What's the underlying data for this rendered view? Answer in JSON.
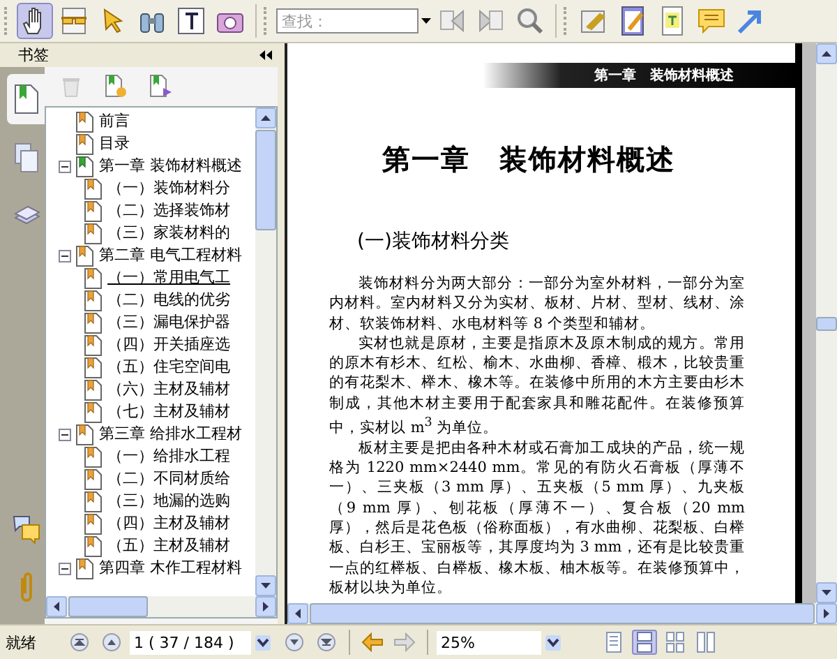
{
  "toolbar": {
    "tools": [
      {
        "kind": "hand",
        "selected": true
      },
      {
        "kind": "glasses",
        "selected": false
      },
      {
        "kind": "arrow",
        "selected": false
      },
      {
        "kind": "binoculars",
        "selected": false
      },
      {
        "kind": "text",
        "selected": false
      },
      {
        "kind": "camera",
        "selected": false
      }
    ],
    "search": {
      "placeholder": "查找："
    },
    "annotation_tools": [
      {
        "kind": "link"
      },
      {
        "kind": "note"
      },
      {
        "kind": "textbox"
      },
      {
        "kind": "comment"
      },
      {
        "kind": "arrow"
      }
    ]
  },
  "sidebar": {
    "title": "书签",
    "tabs": [
      {
        "kind": "bookmarks",
        "selected": true
      },
      {
        "kind": "pages",
        "selected": false
      },
      {
        "kind": "layers",
        "selected": false
      },
      {
        "kind": "comments",
        "selected": false
      },
      {
        "kind": "attachments",
        "selected": false
      }
    ],
    "bookmarks": [
      {
        "label": "前言",
        "current": false,
        "selected": false
      },
      {
        "label": "目录",
        "current": false,
        "selected": false
      },
      {
        "label": "第一章  装饰材料概述",
        "current": true,
        "selected": false,
        "expanded": true,
        "children": [
          {
            "label": "（一）装饰材料分",
            "current": false,
            "selected": false
          },
          {
            "label": "（二）选择装饰材",
            "current": false,
            "selected": false
          },
          {
            "label": "（三）家装材料的",
            "current": false,
            "selected": false
          }
        ]
      },
      {
        "label": "第二章  电气工程材料",
        "current": false,
        "selected": false,
        "expanded": true,
        "children": [
          {
            "label": "（一）常用电气工",
            "current": false,
            "selected": true
          },
          {
            "label": "（二）电线的优劣",
            "current": false,
            "selected": false
          },
          {
            "label": "（三）漏电保护器",
            "current": false,
            "selected": false
          },
          {
            "label": "（四）开关插座选",
            "current": false,
            "selected": false
          },
          {
            "label": "（五）住宅空间电",
            "current": false,
            "selected": false
          },
          {
            "label": "（六）主材及辅材",
            "current": false,
            "selected": false
          },
          {
            "label": "（七）主材及辅材",
            "current": false,
            "selected": false
          }
        ]
      },
      {
        "label": "第三章  给排水工程材",
        "current": false,
        "selected": false,
        "expanded": true,
        "children": [
          {
            "label": "（一）给排水工程",
            "current": false,
            "selected": false
          },
          {
            "label": "（二）不同材质给",
            "current": false,
            "selected": false
          },
          {
            "label": "（三）地漏的选购",
            "current": false,
            "selected": false
          },
          {
            "label": "（四）主材及辅材",
            "current": false,
            "selected": false
          },
          {
            "label": "（五）主材及辅材",
            "current": false,
            "selected": false
          }
        ]
      },
      {
        "label": "第四章  木作工程材料",
        "current": false,
        "selected": false,
        "expanded": true
      }
    ]
  },
  "document": {
    "running_header": "第一章　装饰材料概述",
    "title": "第一章　装饰材料概述",
    "section": "(一)装饰材料分类",
    "paragraphs": [
      "装饰材料分为两大部分：一部分为室外材料，一部分为室内材料。室内材料又分为实材、板材、片材、型材、线材、涂材、软装饰材料、水电材料等 8 个类型和辅材。",
      "实材也就是原材，主要是指原木及原木制成的规方。常用的原木有杉木、红松、榆木、水曲柳、香樟、椴木，比较贵重的有花梨木、榉木、橡木等。在装修中所用的木方主要由杉木制成，其他木材主要用于配套家具和雕花配件。在装修预算中，实材以 m$^{3}$ 为单位。",
      "板材主要是把由各种木材或石膏加工成块的产品，统一规格为 1220 mm×2440 mm。常见的有防火石膏板（厚薄不一）、三夹板（3 mm 厚）、五夹板（5 mm 厚）、九夹板（9 mm 厚）、刨花板（厚薄不一）、复合板（20 mm 厚），然后是花色板（俗称面板），有水曲柳、花梨板、白榉板、白杉王、宝丽板等，其厚度均为 3 mm，还有是比较贵重一点的红榉板、白榉板、橡木板、柚木板等。在装修预算中，板材以块为单位。"
    ]
  },
  "status_bar": {
    "status": "就绪",
    "page_field": "1 ( 37 / 184 )",
    "zoom": "25%",
    "view_modes": [
      {
        "kind": "single",
        "selected": false
      },
      {
        "kind": "continuous",
        "selected": true
      },
      {
        "kind": "facing",
        "selected": false
      },
      {
        "kind": "continuous-facing",
        "selected": false
      }
    ]
  }
}
